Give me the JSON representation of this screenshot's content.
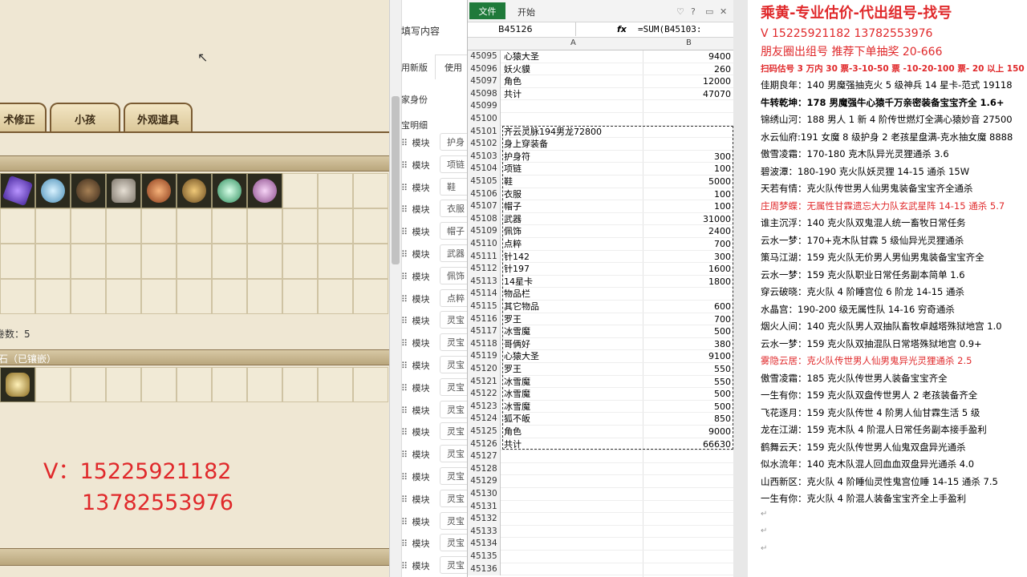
{
  "game": {
    "tabs": [
      "术修正",
      "小孩",
      "外观道具"
    ],
    "section_bar_1": "",
    "count_label": "卷数：5",
    "section_bar_2_label": "石（已镶嵌）",
    "items_row": [
      {
        "icon": "purple-crystal-icon",
        "color": "#7b4bd1"
      },
      {
        "icon": "blue-orb-icon",
        "color": "#6fb3d8"
      },
      {
        "icon": "dark-ring-icon",
        "color": "#7c5a3a"
      },
      {
        "icon": "boots-icon",
        "color": "#b9b0a4"
      },
      {
        "icon": "red-ring-icon",
        "color": "#c76a2a"
      },
      {
        "icon": "gold-ring-icon",
        "color": "#b88a3c"
      },
      {
        "icon": "green-orb-icon",
        "color": "#6fd09a"
      },
      {
        "icon": "pink-orb-icon",
        "color": "#c98dc9"
      }
    ],
    "gem_item": {
      "icon": "gold-crystal-icon",
      "color": "#d8b35a"
    },
    "contact_v": "V：15225921182",
    "contact_v2": "13782553976"
  },
  "form": {
    "header": "填写内容",
    "tabs": [
      "用新版",
      "使用"
    ],
    "role_label": "家身份",
    "detail_label": "宝明细",
    "rows": [
      {
        "label": "模块",
        "chip": "护身"
      },
      {
        "label": "模块",
        "chip": "项链"
      },
      {
        "label": "模块",
        "chip": "鞋"
      },
      {
        "label": "模块",
        "chip": "衣服"
      },
      {
        "label": "模块",
        "chip": "帽子"
      },
      {
        "label": "模块",
        "chip": "武器"
      },
      {
        "label": "模块",
        "chip": "佩饰"
      },
      {
        "label": "模块",
        "chip": "点粹"
      },
      {
        "label": "模块",
        "chip": "灵宝"
      },
      {
        "label": "模块",
        "chip": "灵宝"
      },
      {
        "label": "模块",
        "chip": "灵宝"
      },
      {
        "label": "模块",
        "chip": "灵宝"
      },
      {
        "label": "模块",
        "chip": "灵宝"
      },
      {
        "label": "模块",
        "chip": "灵宝"
      },
      {
        "label": "模块",
        "chip": "灵宝"
      },
      {
        "label": "模块",
        "chip": "灵宝"
      },
      {
        "label": "模块",
        "chip": "灵宝"
      },
      {
        "label": "模块",
        "chip": "灵宝"
      },
      {
        "label": "模块",
        "chip": "灵宝"
      },
      {
        "label": "模块",
        "chip": "灵宝"
      }
    ]
  },
  "excel": {
    "ribbon": {
      "file": "文件",
      "start": "开始"
    },
    "name_box": "B45126",
    "fx": "fx",
    "formula": "=SUM(B45103:",
    "columns": [
      "A",
      "B"
    ],
    "rows": [
      {
        "n": "45095",
        "a": "心猿大圣",
        "b": "9400"
      },
      {
        "n": "45096",
        "a": "妖火貘",
        "b": "260"
      },
      {
        "n": "45097",
        "a": "角色",
        "b": "12000"
      },
      {
        "n": "45098",
        "a": "共计",
        "b": "47070"
      },
      {
        "n": "45099",
        "a": "",
        "b": ""
      },
      {
        "n": "45100",
        "a": "",
        "b": ""
      },
      {
        "n": "45101",
        "a": "齐云灵脉194男龙72800",
        "b": ""
      },
      {
        "n": "45102",
        "a": "身上穿装备",
        "b": ""
      },
      {
        "n": "45103",
        "a": "护身符",
        "b": "300"
      },
      {
        "n": "45104",
        "a": "项链",
        "b": "100"
      },
      {
        "n": "45105",
        "a": "鞋",
        "b": "5000"
      },
      {
        "n": "45106",
        "a": "衣服",
        "b": "100"
      },
      {
        "n": "45107",
        "a": "帽子",
        "b": "100"
      },
      {
        "n": "45108",
        "a": "武器",
        "b": "31000"
      },
      {
        "n": "45109",
        "a": "佩饰",
        "b": "2400"
      },
      {
        "n": "45110",
        "a": "点粹",
        "b": "700"
      },
      {
        "n": "45111",
        "a": "针142",
        "b": "300"
      },
      {
        "n": "45112",
        "a": "针197",
        "b": "1600"
      },
      {
        "n": "45113",
        "a": "14星卡",
        "b": "1800"
      },
      {
        "n": "45114",
        "a": "物品栏",
        "b": ""
      },
      {
        "n": "45115",
        "a": "其它物品",
        "b": "600"
      },
      {
        "n": "45116",
        "a": "罗王",
        "b": "700"
      },
      {
        "n": "45117",
        "a": "冰雪魔",
        "b": "500"
      },
      {
        "n": "45118",
        "a": "哥俩好",
        "b": "380"
      },
      {
        "n": "45119",
        "a": "心猿大圣",
        "b": "9100"
      },
      {
        "n": "45120",
        "a": "罗王",
        "b": "550"
      },
      {
        "n": "45121",
        "a": "冰雪魔",
        "b": "550"
      },
      {
        "n": "45122",
        "a": "冰雪魔",
        "b": "500"
      },
      {
        "n": "45123",
        "a": "冰雪魔",
        "b": "500"
      },
      {
        "n": "45124",
        "a": "狐不皈",
        "b": "850"
      },
      {
        "n": "45125",
        "a": "角色",
        "b": "9000"
      },
      {
        "n": "45126",
        "a": "共计",
        "b": "66630"
      },
      {
        "n": "45127",
        "a": "",
        "b": ""
      },
      {
        "n": "45128",
        "a": "",
        "b": ""
      },
      {
        "n": "45129",
        "a": "",
        "b": ""
      },
      {
        "n": "45130",
        "a": "",
        "b": ""
      },
      {
        "n": "45131",
        "a": "",
        "b": ""
      },
      {
        "n": "45132",
        "a": "",
        "b": ""
      },
      {
        "n": "45133",
        "a": "",
        "b": ""
      },
      {
        "n": "45134",
        "a": "",
        "b": ""
      },
      {
        "n": "45135",
        "a": "",
        "b": ""
      },
      {
        "n": "45136",
        "a": "",
        "b": ""
      }
    ]
  },
  "doc": {
    "title": "乘黄-专业估价-代出组号-找号",
    "contact": "V   15225921182   13782553976",
    "promo": "朋友圈出组号  推荐下单抽奖 20-666",
    "pricing": "扫码估号 3 万内 30 票-3-10-50 票  -10-20-100 票- 20 以上 150",
    "lines": [
      {
        "text": "佳期良年：140 男魔强抽克火 5 级神兵 14 星卡-范式 19118",
        "style": "normal"
      },
      {
        "text": "牛转乾坤：178 男魔强牛心猿千万亲密装备宝宝齐全 1.6+",
        "style": "bold"
      },
      {
        "text": "锦绣山河：188 男人 1 新 4 阶传世燃灯全满心猿妙音 27500",
        "style": "normal"
      },
      {
        "text": "水云仙府:191 女魔 8 级护身 2 老孩星盘满-克水抽女魔 8888",
        "style": "normal"
      },
      {
        "text": "傲雪凌霜：170-180 克木队异光灵狸通杀 3.6",
        "style": "normal"
      },
      {
        "text": "碧波潭：180-190 克火队妖灵狸 14-15 通杀 15W",
        "style": "normal"
      },
      {
        "text": "天若有情：克火队传世男人仙男鬼装备宝宝齐全通杀",
        "style": "normal"
      },
      {
        "text": "庄周梦蝶：无属性甘霖遗忘大力队玄武星阵 14-15 通杀 5.7",
        "style": "red"
      },
      {
        "text": "谁主沉浮：140 克火队双鬼混人统一畜牧日常任务",
        "style": "normal"
      },
      {
        "text": "云水一梦：170+克木队甘霖 5 级仙异光灵狸通杀",
        "style": "normal"
      },
      {
        "text": "策马江湖：159 克火队无价男人男仙男鬼装备宝宝齐全",
        "style": "normal"
      },
      {
        "text": "云水一梦：159 克火队职业日常任务副本简单 1.6",
        "style": "normal"
      },
      {
        "text": "穿云破晓：克火队 4 阶睡宫位 6 阶龙 14-15 通杀",
        "style": "normal"
      },
      {
        "text": "水晶宫：190-200 级无属性队 14-16 穷奇通杀",
        "style": "normal"
      },
      {
        "text": "烟火人间：140 克火队男人双抽队畜牧卓越塔殊狱地宫 1.0",
        "style": "normal"
      },
      {
        "text": "云水一梦：159 克火队双抽混队日常塔殊狱地宫 0.9+",
        "style": "normal"
      },
      {
        "text": "雾隐云居：克火队传世男人仙男鬼异光灵狸通杀 2.5",
        "style": "red"
      },
      {
        "text": "傲雪凌霜：185 克火队传世男人装备宝宝齐全",
        "style": "normal"
      },
      {
        "text": "一生有你：159 克火队双盘传世男人 2 老孩装备齐全",
        "style": "normal"
      },
      {
        "text": "飞花逐月：159 克火队传世 4 阶男人仙甘霖生活 5 级",
        "style": "normal"
      },
      {
        "text": "龙在江湖：159 克木队 4 阶混人日常任务副本接手盈利",
        "style": "normal"
      },
      {
        "text": "鹤舞云天：159 克火队传世男人仙鬼双盘异光通杀",
        "style": "normal"
      },
      {
        "text": "似水流年：140 克木队混人回血血双盘异光通杀 4.0",
        "style": "normal"
      },
      {
        "text": "山西新区：克火队 4 阶睡仙灵性鬼宫位睡 14-15 通杀 7.5",
        "style": "normal"
      },
      {
        "text": "一生有你：克火队 4 阶混人装备宝宝齐全上手盈利",
        "style": "normal"
      }
    ]
  }
}
